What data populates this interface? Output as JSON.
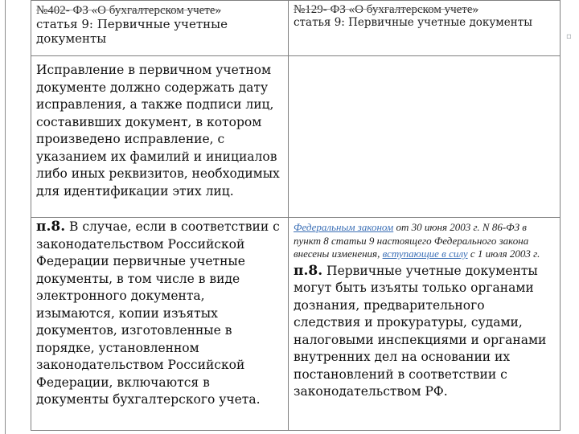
{
  "table": {
    "left_header": {
      "law_title": "№402- ФЗ «О бухгалтерском учете»",
      "article_prefix": "статья 9:",
      "article_title": "Первичные учетные документы"
    },
    "right_header": {
      "law_title": "№129- ФЗ «О бухгалтерском учете»",
      "article_prefix": "статья 9:",
      "article_title": "Первичные учетные документы"
    },
    "row2": {
      "left_text": "Исправление в первичном учетном документе должно содержать дату исправления, а также подписи лиц, составивших документ, в котором произведено исправление, с указанием их фамилий и инициалов либо иных реквизитов, необходимых для идентификации этих лиц.",
      "right_text": ""
    },
    "row3": {
      "left_num": "п.8.",
      "left_text": "В случае, если в соответствии с законодательством Российской Федерации первичные учетные документы, в том числе в виде электронного документа, изымаются, копии изъятых документов, изготовленные в порядке, установленном законодательством Российской Федерации, включаются в документы бухгалтерского учета.",
      "right_note_link1": "Федеральным законом",
      "right_note_mid": "от 30 июня 2003 г. N 86-ФЗ в пункт 8 статьи 9 настоящего Федерального закона внесены изменения,",
      "right_note_link2": "вступающие в силу",
      "right_note_end": "с 1 июля 2003 г.",
      "right_num": "п.8.",
      "right_text": "Первичные учетные документы могут быть изъяты только органами дознания, предварительного следствия и прокуратуры, судами, налоговыми инспекциями и органами внутренних дел на основании их постановлений в соответствии с законодательством РФ."
    }
  },
  "side_mark": "▫"
}
